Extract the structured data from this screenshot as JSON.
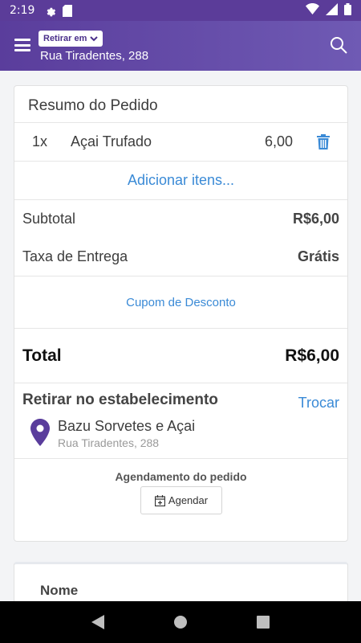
{
  "status_bar": {
    "time": "2:19",
    "icons": [
      "gear-icon",
      "sd-card-icon",
      "wifi-icon",
      "signal-icon",
      "battery-icon"
    ]
  },
  "header": {
    "pickup_mode": "Retirar em",
    "address": "Rua Tiradentes, 288",
    "icons": [
      "menu-icon",
      "chevron-down-icon",
      "search-icon"
    ]
  },
  "order_summary": {
    "title": "Resumo do Pedido",
    "items": [
      {
        "qty": "1x",
        "name": "Açai Trufado",
        "price": "6,00"
      }
    ],
    "add_items": "Adicionar itens...",
    "subtotal_label": "Subtotal",
    "subtotal_value": "R$6,00",
    "delivery_label": "Taxa de Entrega",
    "delivery_value": "Grátis",
    "coupon": "Cupom de Desconto",
    "total_label": "Total",
    "total_value": "R$6,00"
  },
  "pickup": {
    "title": "Retirar no estabelecimento",
    "change": "Trocar",
    "store_name": "Bazu Sorvetes e Açai",
    "store_address": "Rua Tiradentes, 288"
  },
  "schedule": {
    "title": "Agendamento do pedido",
    "button": "Agendar"
  },
  "customer": {
    "name_label": "Nome"
  },
  "colors": {
    "header_start": "#5a3d9c",
    "header_end": "#6f5ab4",
    "link": "#3a8ad6",
    "pin": "#5a3d9c"
  }
}
